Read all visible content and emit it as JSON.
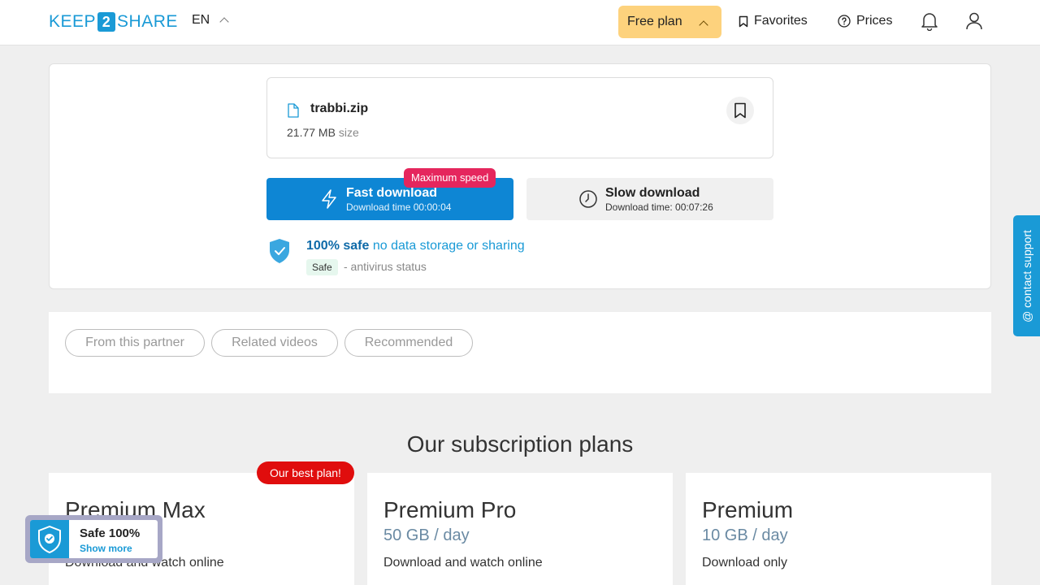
{
  "header": {
    "logo_left": "KEEP",
    "logo_mid": "2",
    "logo_right": "SHARE",
    "language": "EN",
    "free_plan": "Free plan",
    "favorites": "Favorites",
    "prices": "Prices"
  },
  "file": {
    "name": "trabbi.zip",
    "size_value": "21.77 MB",
    "size_unit": "size"
  },
  "download": {
    "fast_title": "Fast download",
    "fast_time": "Download time 00:00:04",
    "max_speed_badge": "Maximum speed",
    "slow_title": "Slow download",
    "slow_time": "Download time: 00:07:26"
  },
  "safety": {
    "strong": "100% safe",
    "light": "no data storage or sharing",
    "tag": "Safe",
    "status": "- antivirus status"
  },
  "tabs": [
    {
      "label": "From this partner"
    },
    {
      "label": "Related videos"
    },
    {
      "label": "Recommended"
    }
  ],
  "plans_title": "Our subscription plans",
  "best_badge": "Our best plan!",
  "plans": [
    {
      "name": "Premium Max",
      "quota": "",
      "desc": "Download and watch online"
    },
    {
      "name": "Premium Pro",
      "quota": "50 GB / day",
      "desc": "Download and watch online"
    },
    {
      "name": "Premium",
      "quota": "10 GB / day",
      "desc": "Download only"
    }
  ],
  "support_tab": "@ contact support",
  "safe_widget": {
    "title": "Safe 100%",
    "link": "Show more"
  },
  "colors": {
    "brand_blue": "#1a9ad6",
    "fast_button": "#0e86d4",
    "free_plan_bg": "#fdd27d",
    "badge_pink": "#e5265d",
    "best_red": "#e00d0d"
  }
}
